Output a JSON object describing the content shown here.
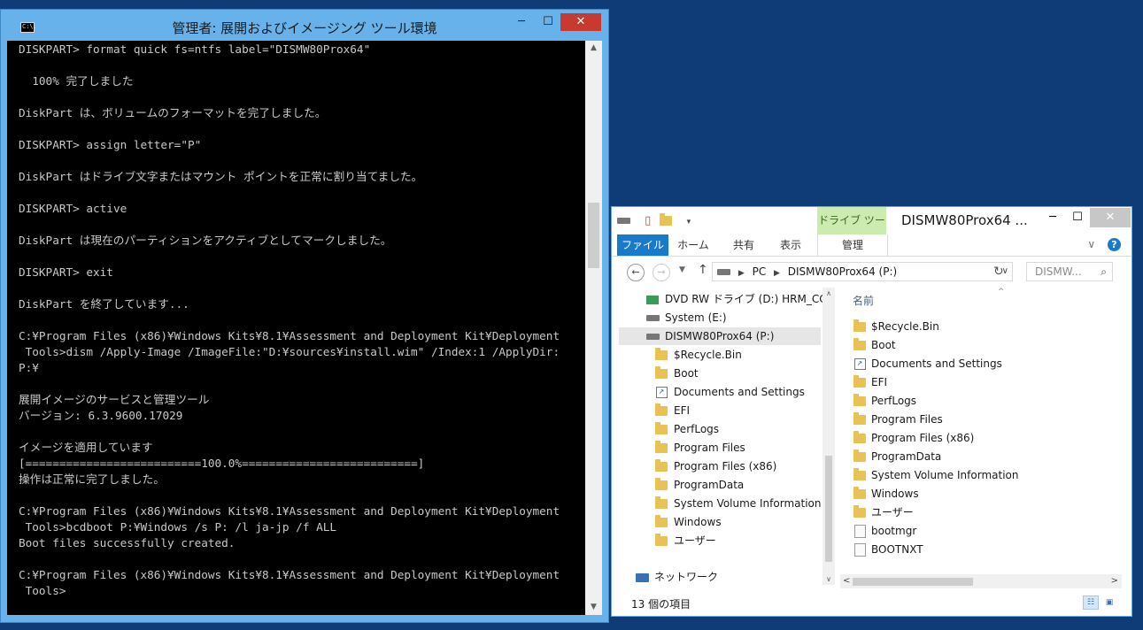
{
  "console": {
    "title": "管理者: 展開およびイメージング ツール環境",
    "icon_text": "C:\\.",
    "lines": [
      "DISKPART> format quick fs=ntfs label=\"DISMW80Prox64\"",
      "",
      "  100% 完了しました",
      "",
      "DiskPart は、ボリュームのフォーマットを完了しました。",
      "",
      "DISKPART> assign letter=\"P\"",
      "",
      "DiskPart はドライブ文字またはマウント ポイントを正常に割り当てました。",
      "",
      "DISKPART> active",
      "",
      "DiskPart は現在のパーティションをアクティブとしてマークしました。",
      "",
      "DISKPART> exit",
      "",
      "DiskPart を終了しています...",
      "",
      "C:¥Program Files (x86)¥Windows Kits¥8.1¥Assessment and Deployment Kit¥Deployment",
      " Tools>dism /Apply-Image /ImageFile:\"D:¥sources¥install.wim\" /Index:1 /ApplyDir:",
      "P:¥",
      "",
      "展開イメージのサービスと管理ツール",
      "バージョン: 6.3.9600.17029",
      "",
      "イメージを適用しています",
      "[==========================100.0%==========================]",
      "操作は正常に完了しました。",
      "",
      "C:¥Program Files (x86)¥Windows Kits¥8.1¥Assessment and Deployment Kit¥Deployment",
      " Tools>bcdboot P:¥Windows /s P: /l ja-jp /f ALL",
      "Boot files successfully created.",
      "",
      "C:¥Program Files (x86)¥Windows Kits¥8.1¥Assessment and Deployment Kit¥Deployment",
      " Tools>"
    ]
  },
  "explorer": {
    "title": "DISMW80Prox64 ...",
    "context_tab": "ドライブ ツール",
    "ribbon": {
      "file": "ファイル",
      "home": "ホーム",
      "share": "共有",
      "view": "表示",
      "manage": "管理"
    },
    "address": {
      "pc": "PC",
      "drive": "DISMW80Prox64 (P:)"
    },
    "search_placeholder": "DISMW...",
    "nav": {
      "dvd": "DVD RW ドライブ (D:) HRM_CCS",
      "system_e": "System (E:)",
      "dism": "DISMW80Prox64 (P:)",
      "children": [
        "$Recycle.Bin",
        "Boot",
        "Documents and Settings",
        "EFI",
        "PerfLogs",
        "Program Files",
        "Program Files (x86)",
        "ProgramData",
        "System Volume Information",
        "Windows",
        "ユーザー"
      ],
      "network": "ネットワーク"
    },
    "content": {
      "column_name": "名前",
      "folders": [
        "$Recycle.Bin",
        "Boot",
        "Documents and Settings",
        "EFI",
        "PerfLogs",
        "Program Files",
        "Program Files (x86)",
        "ProgramData",
        "System Volume Information",
        "Windows",
        "ユーザー"
      ],
      "files": [
        "bootmgr",
        "BOOTNXT"
      ]
    },
    "status": "13 個の項目"
  }
}
